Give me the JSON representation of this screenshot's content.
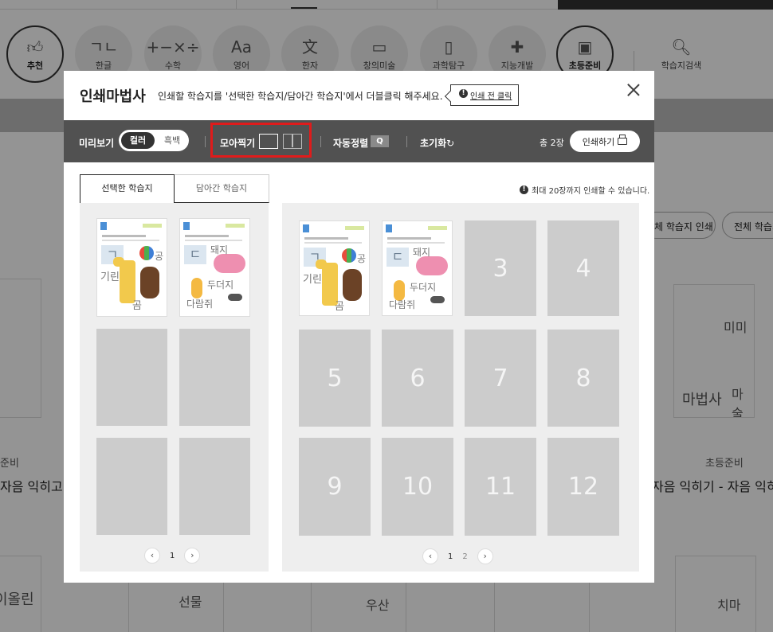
{
  "background": {
    "categories": [
      {
        "label": "추천",
        "icon": "thumbs-up-icon",
        "glyph": "👍︎",
        "active": true
      },
      {
        "label": "한글",
        "icon": "hangul-icon",
        "glyph": "ㄱㄴ",
        "active": false
      },
      {
        "label": "수학",
        "icon": "math-icon",
        "glyph": "+−×÷",
        "active": false
      },
      {
        "label": "영어",
        "icon": "english-icon",
        "glyph": "Aa",
        "active": false
      },
      {
        "label": "한자",
        "icon": "hanja-icon",
        "glyph": "文",
        "active": false
      },
      {
        "label": "창의미술",
        "icon": "art-icon",
        "glyph": "▭",
        "active": false
      },
      {
        "label": "과학탐구",
        "icon": "science-icon",
        "glyph": "▯",
        "active": false
      },
      {
        "label": "지능개발",
        "icon": "puzzle-icon",
        "glyph": "✚",
        "active": false
      },
      {
        "label": "초등준비",
        "icon": "backpack-icon",
        "glyph": "▣",
        "active": true
      },
      {
        "label": "학습지검색",
        "icon": "search-icon",
        "glyph": "🔍︎",
        "active": false
      }
    ],
    "buttons": [
      "체 학습지 인쇄",
      "전체 학습지"
    ],
    "card_left": {
      "category": "준비",
      "title": "자음 익히고 쓰기"
    },
    "card_right": {
      "category": "초등준비",
      "title": "자음 익히기 - 자음 익히기",
      "words": [
        "미미",
        "마법사",
        "마술"
      ]
    },
    "bottom_words": [
      "이올린",
      "선물",
      "우산",
      "치마"
    ]
  },
  "modal": {
    "title": "인쇄마법사",
    "description": "인쇄할 학습지를 '선택한 학습지/담아간 학습지'에서 더블클릭 해주세요.",
    "tip_button": "인쇄 전 클릭",
    "toolbar": {
      "preview_label": "미리보기",
      "color_on": "컬러",
      "color_off": "흑백",
      "combine_label": "모아찍기",
      "autosort_label": "자동정렬",
      "autosort_badge": "Q",
      "reset_label": "초기화",
      "count": "총 2장",
      "print_button": "인쇄하기"
    },
    "tabs": {
      "selected": "선택한 학습지",
      "saved": "담아간 학습지"
    },
    "limit_notice": "최대 20장까지 인쇄할 수 있습니다.",
    "left_pager": {
      "prev": "‹",
      "page": "1",
      "next": "›"
    },
    "right_pager": {
      "prev": "‹",
      "pages": [
        "1",
        "2"
      ],
      "next": "›"
    },
    "sheets": [
      {
        "letter": "ㄱ",
        "words": [
          "기린",
          "공",
          "곰"
        ]
      },
      {
        "letter": "ㄷ",
        "words": [
          "돼지",
          "두더지",
          "다람쥐"
        ]
      }
    ],
    "slots": [
      "3",
      "4",
      "5",
      "6",
      "7",
      "8",
      "9",
      "10",
      "11",
      "12"
    ]
  }
}
